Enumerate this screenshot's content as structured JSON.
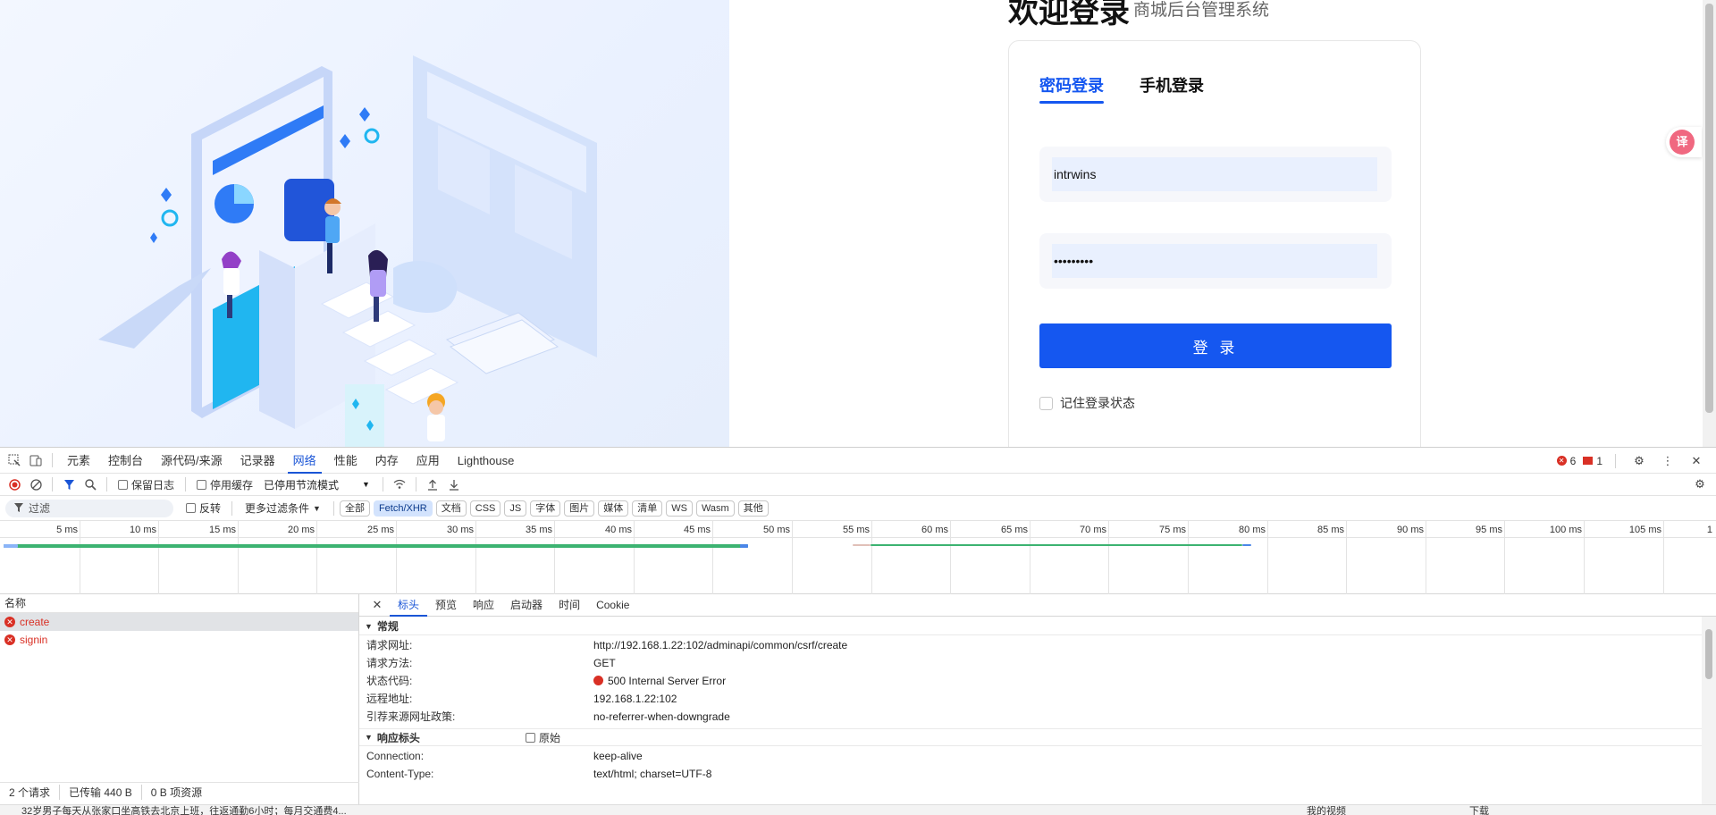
{
  "login": {
    "welcome_title": "欢迎登录",
    "welcome_sub": "商城后台管理系统",
    "tab_password": "密码登录",
    "tab_phone": "手机登录",
    "username_value": "intrwins",
    "password_value": "•••••••••",
    "submit_label": "登 录",
    "remember_label": "记住登录状态",
    "translate_icon": "译",
    "accent_color": "#1557f0"
  },
  "devtools": {
    "panel_tabs": [
      "元素",
      "控制台",
      "源代码/来源",
      "记录器",
      "网络",
      "性能",
      "内存",
      "应用",
      "Lighthouse"
    ],
    "active_tab": "网络",
    "error_count": "6",
    "warning_count": "1",
    "toolbar": {
      "preserve_log": "保留日志",
      "disable_cache": "停用缓存",
      "throttle": "已停用节流模式"
    },
    "filter": {
      "placeholder": "过滤",
      "invert": "反转",
      "more_filters": "更多过滤条件",
      "chips": [
        "全部",
        "Fetch/XHR",
        "文档",
        "CSS",
        "JS",
        "字体",
        "图片",
        "媒体",
        "清单",
        "WS",
        "Wasm",
        "其他"
      ],
      "active_chip": "Fetch/XHR"
    },
    "timeline_ticks": [
      "5 ms",
      "10 ms",
      "15 ms",
      "20 ms",
      "25 ms",
      "30 ms",
      "35 ms",
      "40 ms",
      "45 ms",
      "50 ms",
      "55 ms",
      "60 ms",
      "65 ms",
      "70 ms",
      "75 ms",
      "80 ms",
      "85 ms",
      "90 ms",
      "95 ms",
      "100 ms",
      "105 ms",
      "1"
    ],
    "request_list": {
      "header": "名称",
      "requests": [
        "create",
        "signin"
      ],
      "footer": [
        "2 个请求",
        "已传输 440 B",
        "0 B 项资源"
      ]
    },
    "detail": {
      "tabs": [
        "标头",
        "预览",
        "响应",
        "启动器",
        "时间",
        "Cookie"
      ],
      "active_tab": "标头",
      "general_title": "常规",
      "general": [
        {
          "key": "请求网址:",
          "value": "http://192.168.1.22:102/adminapi/common/csrf/create"
        },
        {
          "key": "请求方法:",
          "value": "GET"
        },
        {
          "key": "状态代码:",
          "value": "500 Internal Server Error"
        },
        {
          "key": "远程地址:",
          "value": "192.168.1.22:102"
        },
        {
          "key": "引荐来源网址政策:",
          "value": "no-referrer-when-downgrade"
        }
      ],
      "response_headers_title": "响应标头",
      "raw_label": "原始",
      "response_headers": [
        {
          "key": "Connection:",
          "value": "keep-alive"
        },
        {
          "key": "Content-Type:",
          "value": "text/html; charset=UTF-8"
        }
      ]
    }
  },
  "bottom_bar": {
    "news": "32岁男子每天从张家口坐高铁去北京上班，往返通勤6小时；每月交通费4...",
    "items": [
      "我的视频",
      "下载"
    ]
  }
}
